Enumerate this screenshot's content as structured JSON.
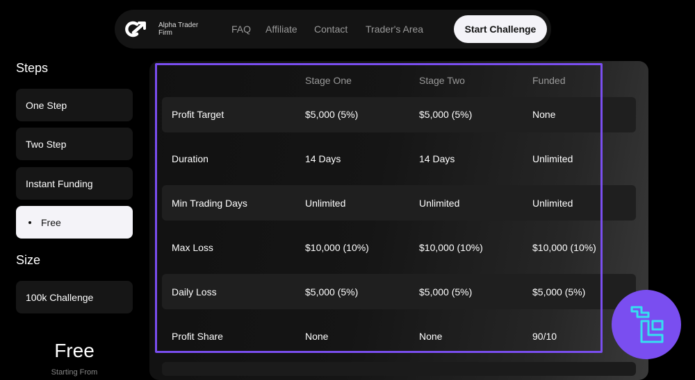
{
  "nav": {
    "brand": "Alpha Trader Firm",
    "links": [
      "FAQ",
      "Affiliate",
      "Contact",
      "Trader's Area"
    ],
    "cta": "Start Challenge"
  },
  "sidebar": {
    "steps_heading": "Steps",
    "steps": [
      {
        "label": "One Step",
        "active": false
      },
      {
        "label": "Two Step",
        "active": false
      },
      {
        "label": "Instant Funding",
        "active": false
      },
      {
        "label": "Free",
        "active": true
      }
    ],
    "size_heading": "Size",
    "sizes": [
      {
        "label": "100k Challenge"
      }
    ],
    "plan_name": "Free",
    "plan_subtitle": "Starting From"
  },
  "table": {
    "columns": [
      "",
      "Stage One",
      "Stage Two",
      "Funded"
    ],
    "rows": [
      {
        "label": "Profit Target",
        "values": [
          "$5,000 (5%)",
          "$5,000 (5%)",
          "None"
        ]
      },
      {
        "label": "Duration",
        "values": [
          "14 Days",
          "14 Days",
          "Unlimited"
        ]
      },
      {
        "label": "Min Trading Days",
        "values": [
          "Unlimited",
          "Unlimited",
          "Unlimited"
        ]
      },
      {
        "label": "Max Loss",
        "values": [
          "$10,000 (10%)",
          "$10,000 (10%)",
          "$10,000 (10%)"
        ]
      },
      {
        "label": "Daily Loss",
        "values": [
          "$5,000 (5%)",
          "$5,000 (5%)",
          "$5,000 (5%)"
        ]
      },
      {
        "label": "Profit Share",
        "values": [
          "None",
          "None",
          "90/10"
        ]
      }
    ]
  },
  "colors": {
    "accent": "#7a4ef0",
    "badge_icon": "#35e0f0"
  }
}
